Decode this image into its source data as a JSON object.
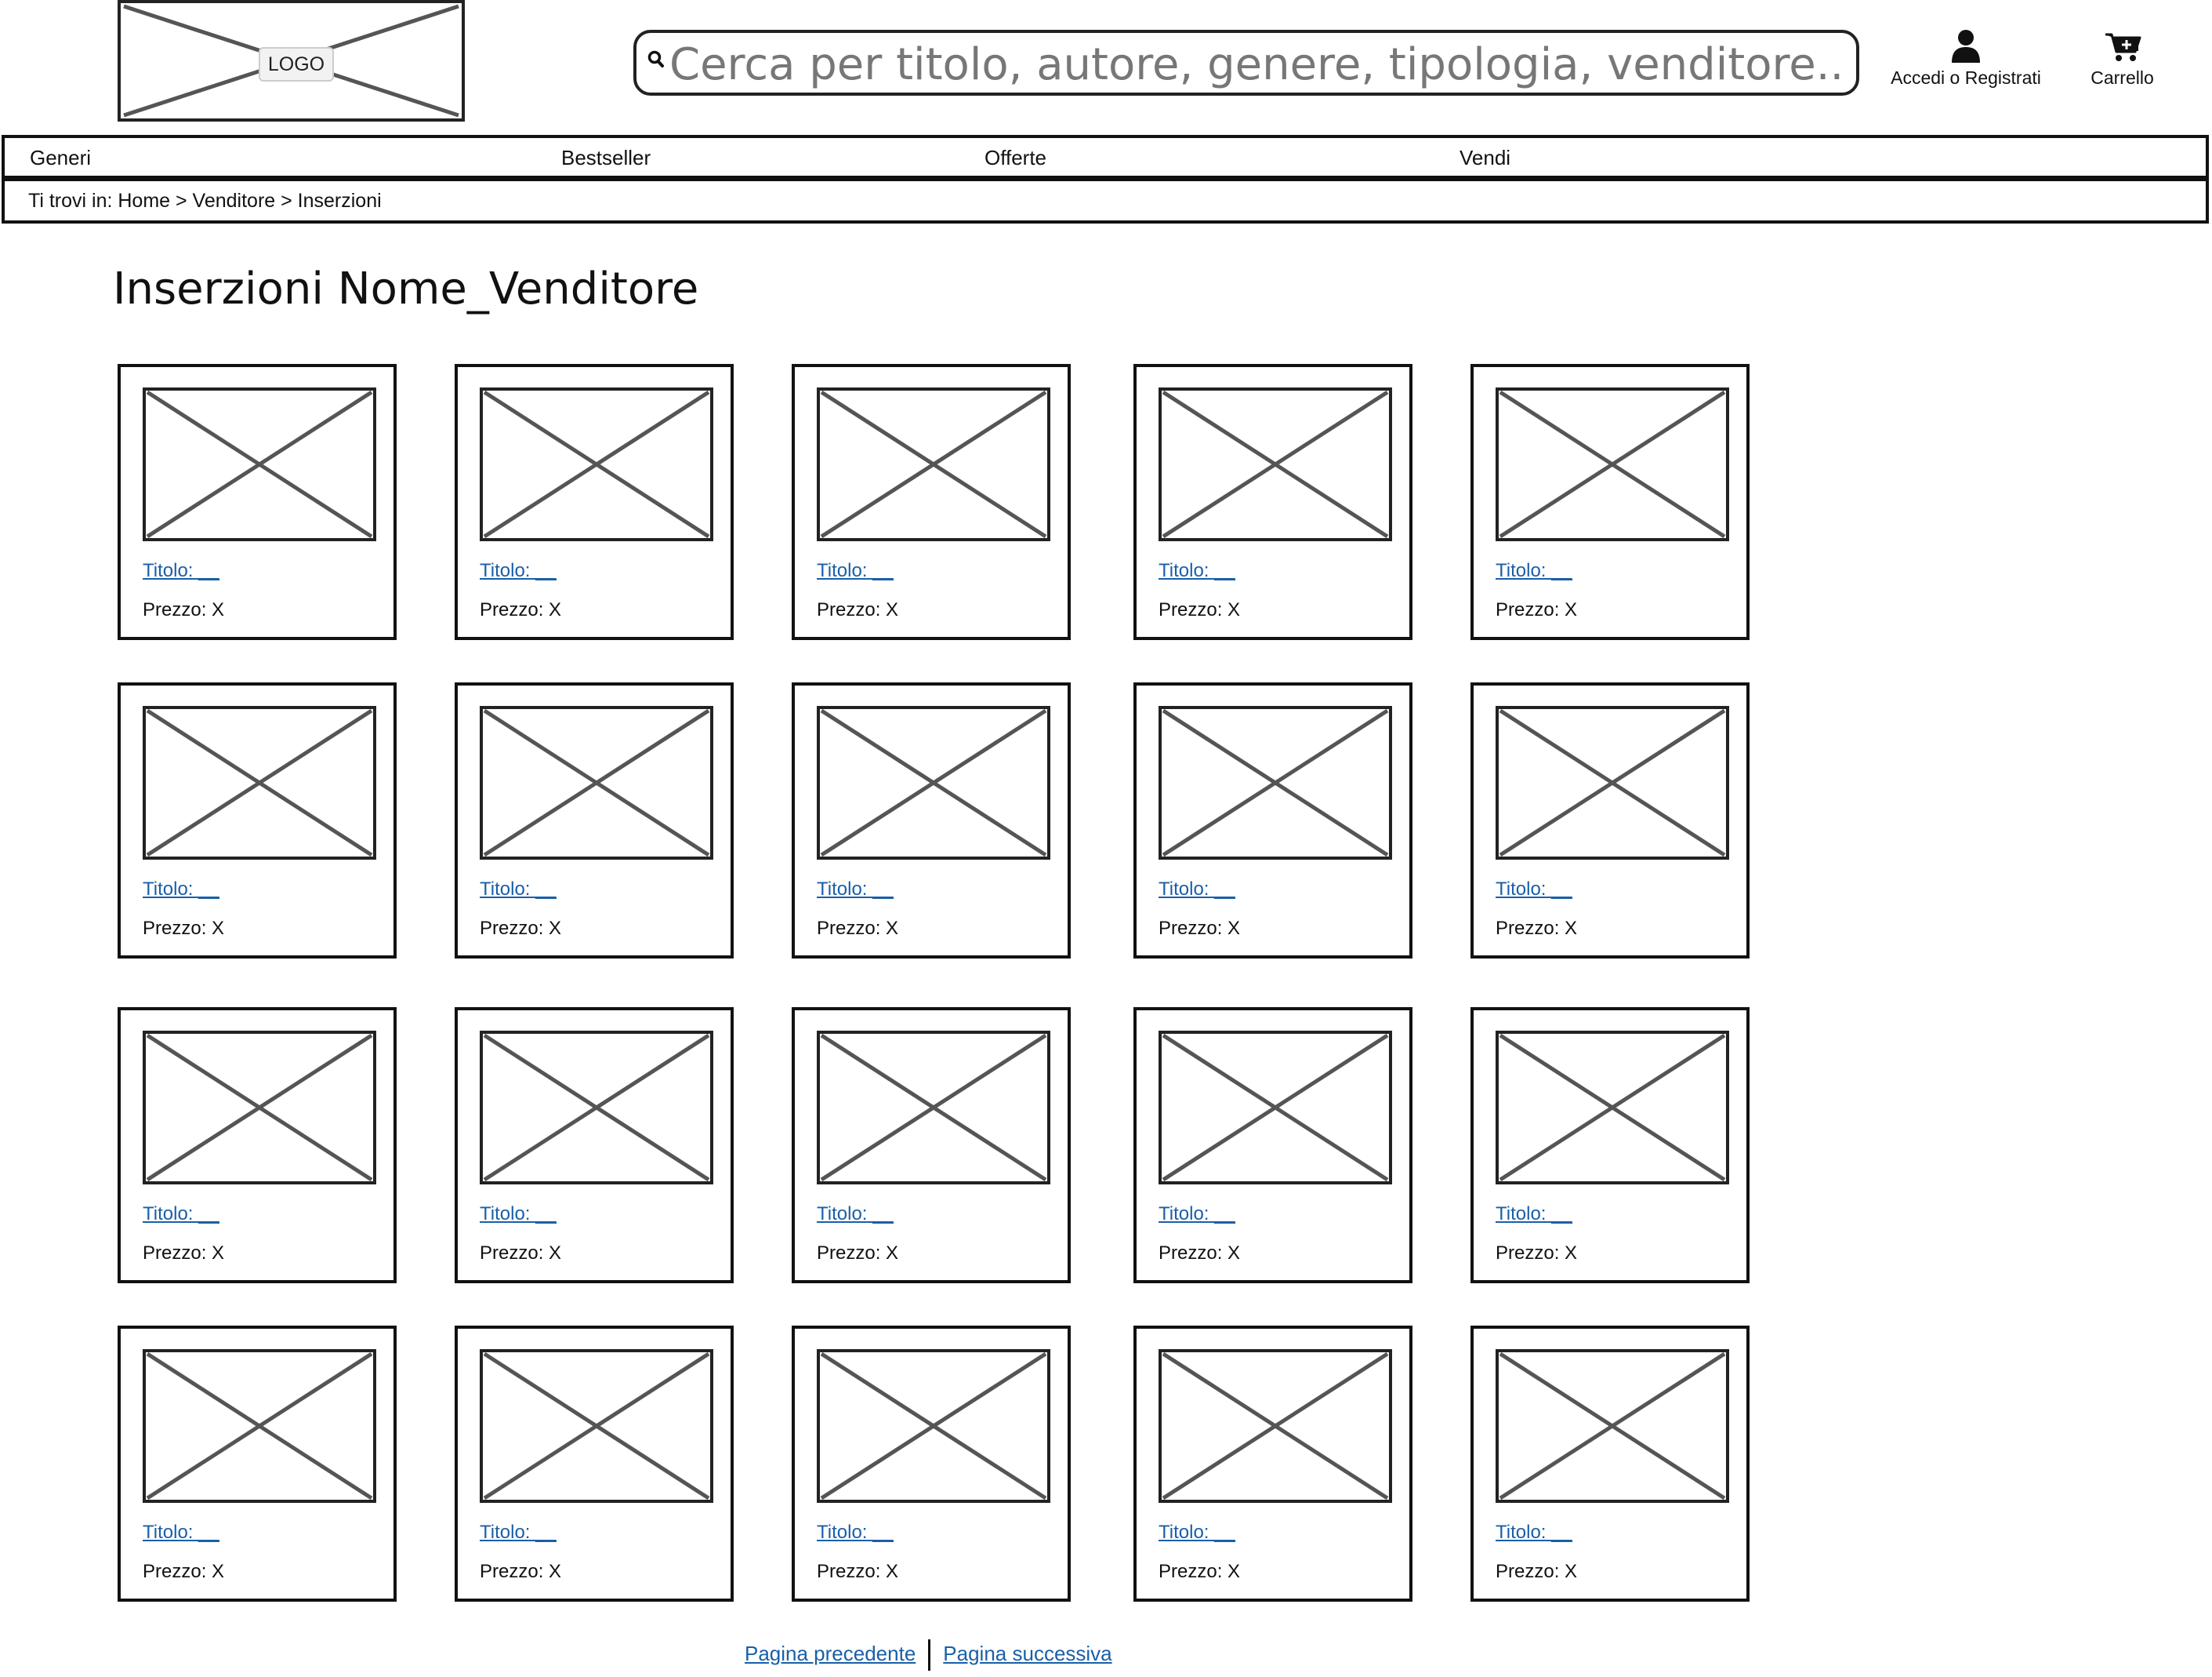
{
  "header": {
    "logo_label": "LOGO",
    "search_placeholder": "Cerca per titolo, autore, genere, tipologia, venditore...",
    "login_label": "Accedi o Registrati",
    "cart_label": "Carrello"
  },
  "nav": {
    "items": [
      {
        "label": "Generi"
      },
      {
        "label": "Bestseller"
      },
      {
        "label": "Offerte"
      },
      {
        "label": "Vendi"
      }
    ]
  },
  "breadcrumb": {
    "text": "Ti trovi in: Home > Venditore > Inserzioni"
  },
  "page": {
    "title": "Inserzioni Nome_Venditore"
  },
  "listings": [
    {
      "title": "Titolo: __",
      "price": "Prezzo: X"
    },
    {
      "title": "Titolo: __",
      "price": "Prezzo: X"
    },
    {
      "title": "Titolo: __",
      "price": "Prezzo: X"
    },
    {
      "title": "Titolo: __",
      "price": "Prezzo: X"
    },
    {
      "title": "Titolo: __",
      "price": "Prezzo: X"
    },
    {
      "title": "Titolo: __",
      "price": "Prezzo: X"
    },
    {
      "title": "Titolo: __",
      "price": "Prezzo: X"
    },
    {
      "title": "Titolo: __",
      "price": "Prezzo: X"
    },
    {
      "title": "Titolo: __",
      "price": "Prezzo: X"
    },
    {
      "title": "Titolo: __",
      "price": "Prezzo: X"
    },
    {
      "title": "Titolo: __",
      "price": "Prezzo: X"
    },
    {
      "title": "Titolo: __",
      "price": "Prezzo: X"
    },
    {
      "title": "Titolo: __",
      "price": "Prezzo: X"
    },
    {
      "title": "Titolo: __",
      "price": "Prezzo: X"
    },
    {
      "title": "Titolo: __",
      "price": "Prezzo: X"
    },
    {
      "title": "Titolo: __",
      "price": "Prezzo: X"
    },
    {
      "title": "Titolo: __",
      "price": "Prezzo: X"
    },
    {
      "title": "Titolo: __",
      "price": "Prezzo: X"
    },
    {
      "title": "Titolo: __",
      "price": "Prezzo: X"
    },
    {
      "title": "Titolo: __",
      "price": "Prezzo: X"
    }
  ],
  "pagination": {
    "prev_label": "Pagina precedente",
    "next_label": "Pagina successiva"
  },
  "colors": {
    "link": "#1a5fa8",
    "border": "#111111",
    "placeholder_stroke": "#555555"
  },
  "icons": {
    "search": "search-icon",
    "user": "user-icon",
    "cart": "cart-icon"
  }
}
